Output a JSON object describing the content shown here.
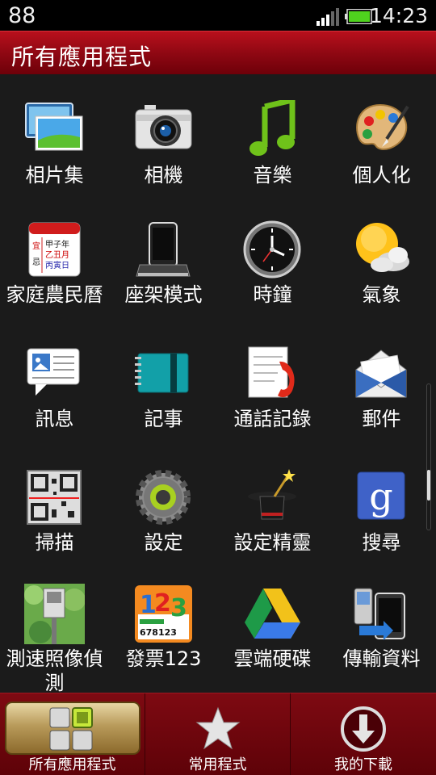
{
  "status": {
    "left_text": "88",
    "time": "14:23"
  },
  "header": {
    "title": "所有應用程式"
  },
  "apps": [
    {
      "label": "相片集",
      "icon": "gallery-icon"
    },
    {
      "label": "相機",
      "icon": "camera-icon"
    },
    {
      "label": "音樂",
      "icon": "music-icon"
    },
    {
      "label": "個人化",
      "icon": "personalize-icon"
    },
    {
      "label": "家庭農民曆",
      "icon": "calendar-icon"
    },
    {
      "label": "座架模式",
      "icon": "dock-icon"
    },
    {
      "label": "時鐘",
      "icon": "clock-icon"
    },
    {
      "label": "氣象",
      "icon": "weather-icon"
    },
    {
      "label": "訊息",
      "icon": "messages-icon"
    },
    {
      "label": "記事",
      "icon": "notes-icon"
    },
    {
      "label": "通話記錄",
      "icon": "call-log-icon"
    },
    {
      "label": "郵件",
      "icon": "mail-icon"
    },
    {
      "label": "掃描",
      "icon": "scanner-icon"
    },
    {
      "label": "設定",
      "icon": "settings-gear-icon"
    },
    {
      "label": "設定精靈",
      "icon": "setup-wizard-icon"
    },
    {
      "label": "搜尋",
      "icon": "google-search-icon"
    },
    {
      "label": "測速照像偵測",
      "icon": "speed-camera-icon"
    },
    {
      "label": "發票123",
      "icon": "invoice-icon"
    },
    {
      "label": "雲端硬碟",
      "icon": "drive-icon"
    },
    {
      "label": "傳輸資料",
      "icon": "transfer-icon"
    }
  ],
  "calendar_icon_text": {
    "left": "宜\n忌",
    "lines": [
      "甲子年",
      "乙丑月",
      "丙寅日"
    ]
  },
  "invoice_icon_text": {
    "big": "123",
    "small": "678123"
  },
  "bottom_tabs": [
    {
      "label": "所有應用程式",
      "icon": "all-apps-grid-icon",
      "selected": true
    },
    {
      "label": "常用程式",
      "icon": "star-icon",
      "selected": false
    },
    {
      "label": "我的下載",
      "icon": "download-arrow-icon",
      "selected": false
    }
  ],
  "colors": {
    "titlebar": "#9a0a15",
    "background": "#1b1b1b",
    "bottombar": "#6e050c"
  }
}
